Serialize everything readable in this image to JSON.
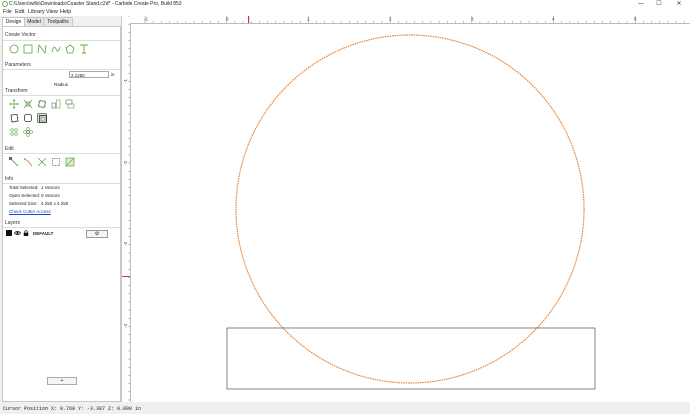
{
  "window": {
    "title": "C:\\Users\\willo\\Downloads\\Coaster Stand.c2d* - Carbide Create Pro, Build 853",
    "minimize_glyph": "—",
    "maximize_glyph": "☐",
    "close_glyph": "✕"
  },
  "menu": {
    "file": "File",
    "edit": "Edit",
    "library": "Library",
    "view": "View",
    "help": "Help"
  },
  "tabs": {
    "design": "Design",
    "model": "Model",
    "toolpaths": "Toolpaths"
  },
  "sections": {
    "create_vector": "Create Vector",
    "parameters": "Parameters",
    "transform": "Transform",
    "edit": "Edit",
    "info": "Info",
    "layers": "Layers"
  },
  "parameters": {
    "radius_label": "Radius",
    "radius_value": "2.1250",
    "radius_unit": "in"
  },
  "info": {
    "total_selected_label": "Total Selected:",
    "total_selected_value": "1 Vectors",
    "open_selected_label": "Open Selected:",
    "open_selected_value": "0 Vectors",
    "selected_size_label": "Selected Size:",
    "selected_size_value": "4.250 x 4.250",
    "check_cutter_access": "Check Cutter Access"
  },
  "layers": {
    "default_name": "DEFAULT",
    "gear_glyph": "⚙",
    "add_button": "+"
  },
  "ruler_h": {
    "labels": [
      "-1",
      "0",
      "1",
      "2",
      "3",
      "4",
      "5"
    ]
  },
  "ruler_v": {
    "labels": [
      "-1",
      "-2",
      "-3",
      "-4"
    ]
  },
  "status": {
    "cursor_position": "Cursor Position X: 0.760 Y: -3.387 Z: 0.000 in"
  },
  "colors": {
    "accent_green": "#5aa83c",
    "circle_orange": "#e8883a",
    "ruler_marker_red": "#e03030"
  }
}
